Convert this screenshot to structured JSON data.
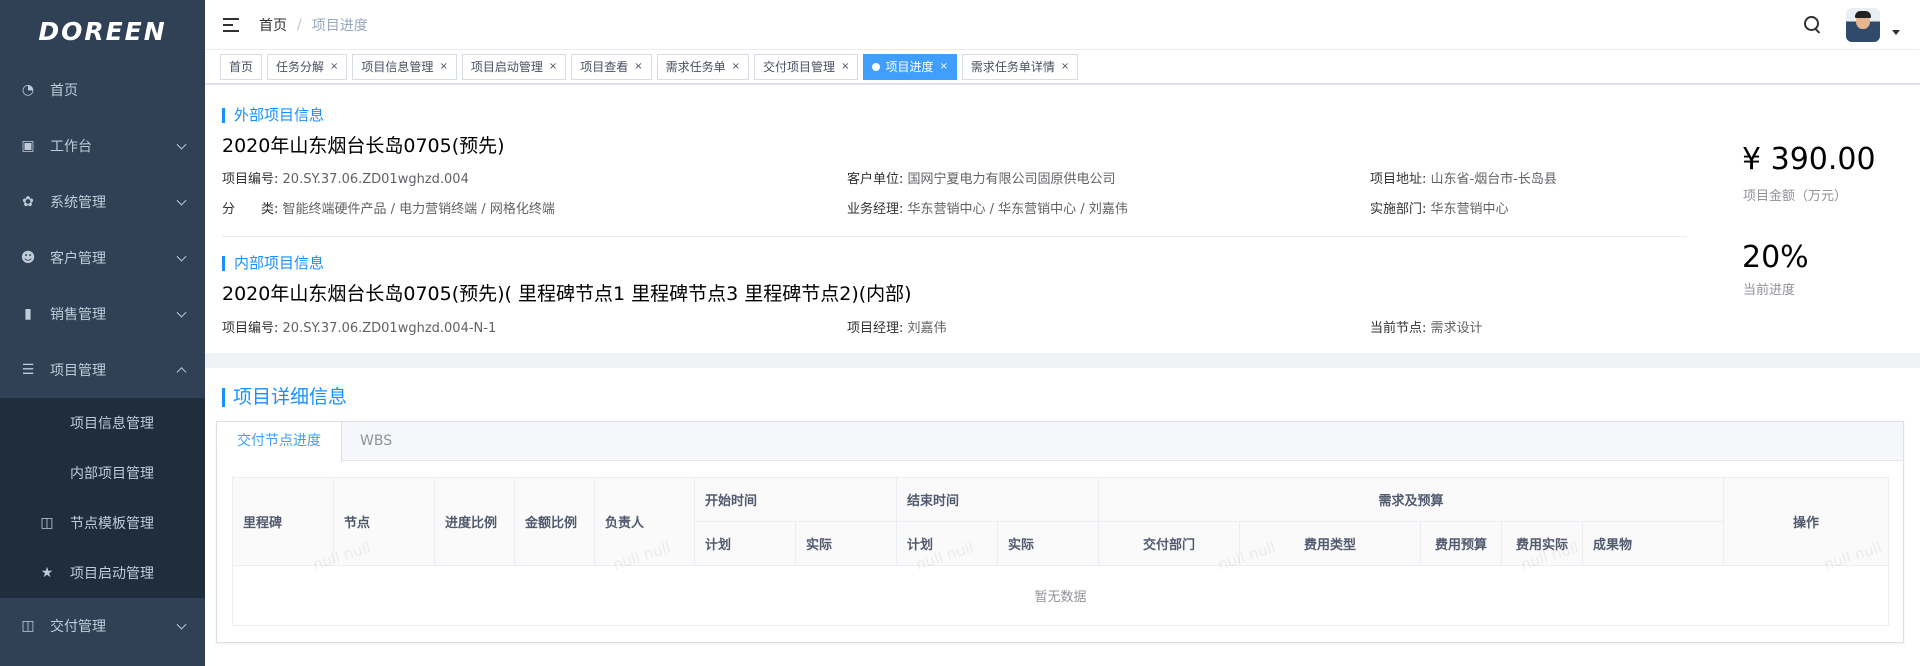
{
  "app": {
    "logo": "DOREEN"
  },
  "sidebar": {
    "items": [
      {
        "label": "首页",
        "icon": "dashboard-icon"
      },
      {
        "label": "工作台",
        "icon": "workbench-icon"
      },
      {
        "label": "系统管理",
        "icon": "gear-icon"
      },
      {
        "label": "客户管理",
        "icon": "user-icon"
      },
      {
        "label": "销售管理",
        "icon": "sales-icon"
      },
      {
        "label": "项目管理",
        "icon": "list-icon"
      }
    ],
    "project_sub": [
      {
        "label": "项目信息管理"
      },
      {
        "label": "内部项目管理"
      },
      {
        "label": "节点模板管理",
        "icon": "book-icon"
      },
      {
        "label": "项目启动管理",
        "icon": "star-icon"
      }
    ],
    "delivery": {
      "label": "交付管理",
      "icon": "book-icon"
    }
  },
  "navbar": {
    "breadcrumb_home": "首页",
    "breadcrumb_sep": "/",
    "breadcrumb_current": "项目进度"
  },
  "tags": [
    "首页",
    "任务分解",
    "项目信息管理",
    "项目启动管理",
    "项目查看",
    "需求任务单",
    "交付项目管理",
    "项目进度",
    "需求任务单详情"
  ],
  "external": {
    "title": "外部项目信息",
    "name": "2020年山东烟台长岛0705(预先)",
    "code_label": "项目编号:",
    "code": "20.SY.37.06.ZD01wghzd.004",
    "customer_label": "客户单位:",
    "customer": "国网宁夏电力有限公司固原供电公司",
    "address_label": "项目地址:",
    "address": "山东省-烟台市-长岛县",
    "category_label": "分　　类:",
    "category": "智能终端硬件产品 / 电力营销终端 / 网格化终端",
    "manager_label": "业务经理:",
    "manager": "华东营销中心 / 华东营销中心 / 刘嘉伟",
    "dept_label": "实施部门:",
    "dept": "华东营销中心",
    "amount": "¥ 390.00",
    "amount_label": "项目金额（万元）"
  },
  "internal": {
    "title": "内部项目信息",
    "name": "2020年山东烟台长岛0705(预先)( 里程碑节点1 里程碑节点3 里程碑节点2)(内部)",
    "code_label": "项目编号:",
    "code": "20.SY.37.06.ZD01wghzd.004-N-1",
    "pm_label": "项目经理:",
    "pm": "刘嘉伟",
    "node_label": "当前节点:",
    "node": "需求设计",
    "progress": "20%",
    "progress_label": "当前进度"
  },
  "detail": {
    "title": "项目详细信息",
    "tabs": [
      "交付节点进度",
      "WBS"
    ],
    "headers": {
      "milestone": "里程碑",
      "node": "节点",
      "progress_ratio": "进度比例",
      "amount_ratio": "金额比例",
      "owner": "负责人",
      "start": "开始时间",
      "end": "结束时间",
      "plan": "计划",
      "actual": "实际",
      "demand": "需求及预算",
      "dept": "交付部门",
      "fee_type": "费用类型",
      "fee_budget": "费用预算",
      "fee_actual": "费用实际",
      "output": "成果物",
      "ops": "操作"
    },
    "empty": "暂无数据",
    "watermark": "null null"
  }
}
